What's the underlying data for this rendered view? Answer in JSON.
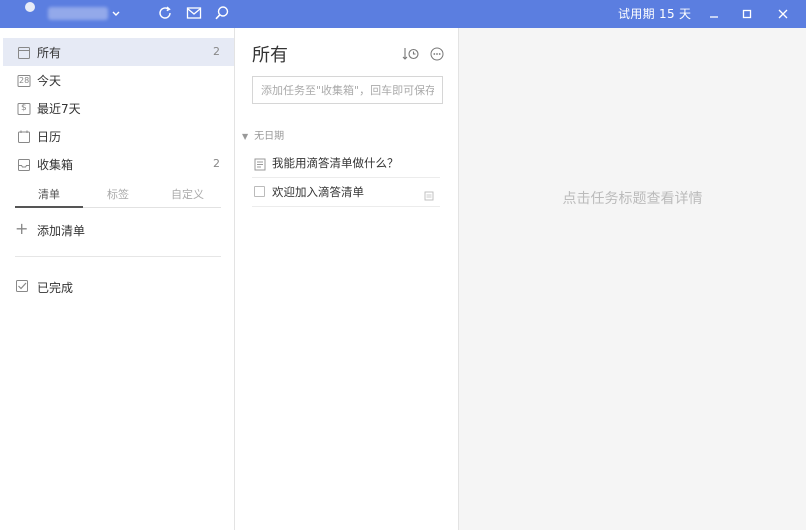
{
  "titlebar": {
    "trial_text": "试用期 15 天",
    "icons": [
      "chevron-down-icon",
      "sync-icon",
      "mail-icon",
      "search-icon",
      "minimize-icon",
      "maximize-icon",
      "close-icon"
    ],
    "accent_color": "#5b7ee0"
  },
  "sidebar": {
    "items": [
      {
        "label": "所有",
        "count": "2",
        "icon": "all-icon",
        "active": true
      },
      {
        "label": "今天",
        "count": "",
        "icon": "today-calendar-icon"
      },
      {
        "label": "最近7天",
        "count": "",
        "icon": "week-calendar-icon"
      },
      {
        "label": "日历",
        "count": "",
        "icon": "calendar-icon"
      },
      {
        "label": "收集箱",
        "count": "2",
        "icon": "inbox-icon"
      }
    ],
    "today_icon_number": "28",
    "week_icon_symbol": "$",
    "tabs": [
      "清单",
      "标签",
      "自定义"
    ],
    "add_list_label": "添加清单",
    "completed_label": "已完成"
  },
  "middle": {
    "title": "所有",
    "add_task_placeholder": "添加任务至\"收集箱\"，回车即可保存",
    "group_label": "无日期",
    "tasks": [
      {
        "title": "我能用滴答清单做什么？",
        "icon": "note-icon"
      },
      {
        "title": "欢迎加入滴答清单",
        "icon": "checkbox"
      }
    ]
  },
  "detail": {
    "hint": "点击任务标题查看详情"
  }
}
